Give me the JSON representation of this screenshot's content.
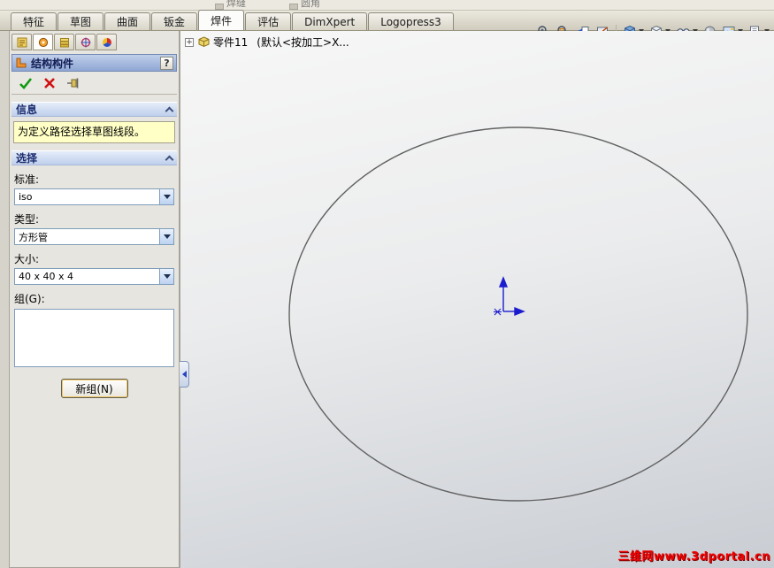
{
  "colors": {
    "active_tab_bg": "#fcfcfa",
    "panel_bg": "#e7e5e0",
    "pm_title_text": "#101c54",
    "section_header_text": "#1a2c6e",
    "message_bg": "#ffffc6",
    "watermark_red": "#f20000",
    "origin_blue": "#1c1ccf",
    "sketch_stroke": "#616161"
  },
  "top_partial_toolbar": {
    "items": [
      {
        "label": "焊缝"
      },
      {
        "label": "圆角"
      }
    ]
  },
  "command_tabs": [
    {
      "label": "特征",
      "active": false
    },
    {
      "label": "草图",
      "active": false
    },
    {
      "label": "曲面",
      "active": false
    },
    {
      "label": "钣金",
      "active": false
    },
    {
      "label": "焊件",
      "active": true
    },
    {
      "label": "评估",
      "active": false
    },
    {
      "label": "DimXpert",
      "active": false
    },
    {
      "label": "Logopress3",
      "active": false
    }
  ],
  "view_toolbar_icons": [
    "zoom-fit",
    "zoom-area",
    "previous-view",
    "section-view",
    "view-orientation",
    "display-style",
    "hide-show-items",
    "edit-appearance",
    "apply-scene",
    "view-settings"
  ],
  "feature_tree": {
    "expand_glyph": "+",
    "part_name": "零件11",
    "config_text": "(默认<按加工>X..."
  },
  "panel_tabs": [
    "feature-manager",
    "property-manager",
    "configuration-manager",
    "dimxpert-manager",
    "display-manager"
  ],
  "property_manager": {
    "title": "结构构件",
    "help_label": "?",
    "info_header": "信息",
    "info_message": "为定义路径选择草图线段。",
    "selection_header": "选择",
    "standard_label": "标准:",
    "standard_value": "iso",
    "type_label": "类型:",
    "type_value": "方形管",
    "size_label": "大小:",
    "size_value": "40 x 40 x 4",
    "group_label": "组(G):",
    "new_group_button": "新组(N)"
  },
  "canvas": {
    "watermark": "三维网www.3dportal.cn"
  }
}
